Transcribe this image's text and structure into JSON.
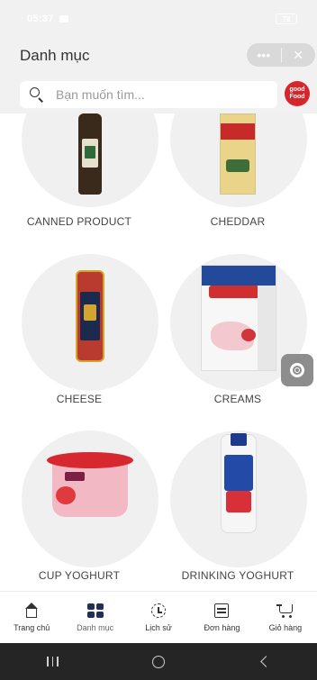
{
  "status_bar": {
    "time": "05:37",
    "battery": "78"
  },
  "header": {
    "title": "Danh mục",
    "capsule_more": "•••",
    "capsule_close": "✕"
  },
  "search": {
    "placeholder": "Bạn muốn tìm..."
  },
  "brand": {
    "line1": "good",
    "line2": "Food",
    "color": "#d7262b"
  },
  "categories": [
    {
      "label": "CANNED PRODUCT"
    },
    {
      "label": "CHEDDAR"
    },
    {
      "label": "CHEESE"
    },
    {
      "label": "CREAMS"
    },
    {
      "label": "CUP YOGHURT"
    },
    {
      "label": "DRINKING YOGHURT"
    }
  ],
  "bottom_nav": {
    "items": [
      {
        "label": "Trang chủ",
        "icon": "home-icon"
      },
      {
        "label": "Danh mục",
        "icon": "category-grid-icon",
        "active": true
      },
      {
        "label": "Lịch sử",
        "icon": "history-icon"
      },
      {
        "label": "Đơn hàng",
        "icon": "orders-icon"
      },
      {
        "label": "Giỏ hàng",
        "icon": "cart-icon"
      }
    ]
  },
  "colors": {
    "header_bg": "#f1f1f1",
    "active_nav": "#1f2f55",
    "system_nav": "#252525"
  }
}
